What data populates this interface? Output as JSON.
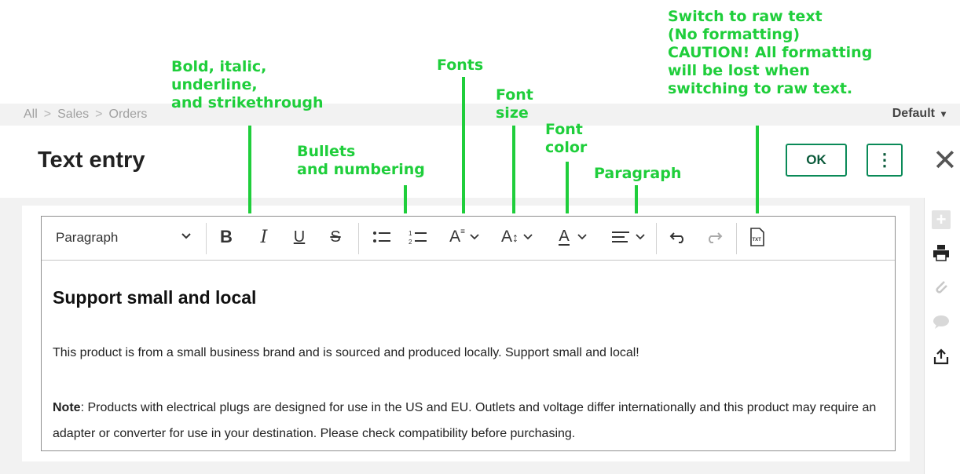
{
  "breadcrumb": [
    "All",
    "Sales",
    "Orders"
  ],
  "view_selector": {
    "label": "Default"
  },
  "header": {
    "title": "Text entry",
    "ok_label": "OK"
  },
  "toolbar": {
    "paragraph_select": "Paragraph",
    "icons": [
      "bold-icon",
      "italic-icon",
      "underline-icon",
      "strikethrough-icon",
      "bullet-list-icon",
      "numbered-list-icon",
      "font-family-icon",
      "font-size-icon",
      "font-color-icon",
      "align-icon",
      "undo-icon",
      "redo-icon",
      "raw-text-icon"
    ]
  },
  "content": {
    "heading": "Support small and local",
    "paragraph1": "This product is from a small business brand and is sourced and produced locally. Support small and local!",
    "note_label": "Note",
    "paragraph2": ": Products with electrical plugs are designed for use in the US and EU. Outlets and voltage differ internationally and this product may require an adapter or converter for use in your destination. Please check compatibility before purchasing."
  },
  "right_rail": [
    "plus-icon",
    "print-icon",
    "attachment-icon",
    "comment-icon",
    "share-icon"
  ],
  "annotations": {
    "formatting": [
      "Bold, italic,",
      "underline,",
      "and strikethrough"
    ],
    "bullets": [
      "Bullets",
      "and numbering"
    ],
    "fonts": [
      "Fonts"
    ],
    "font_size": [
      "Font",
      "size"
    ],
    "font_color": [
      "Font",
      "color"
    ],
    "paragraph": [
      "Paragraph"
    ],
    "raw_text": [
      "Switch to raw text",
      "(No formatting)",
      "CAUTION! All formatting",
      "will be lost when",
      "switching to raw text."
    ]
  },
  "colors": {
    "annotation": "#1fce3b",
    "accent": "#0a8a58"
  }
}
